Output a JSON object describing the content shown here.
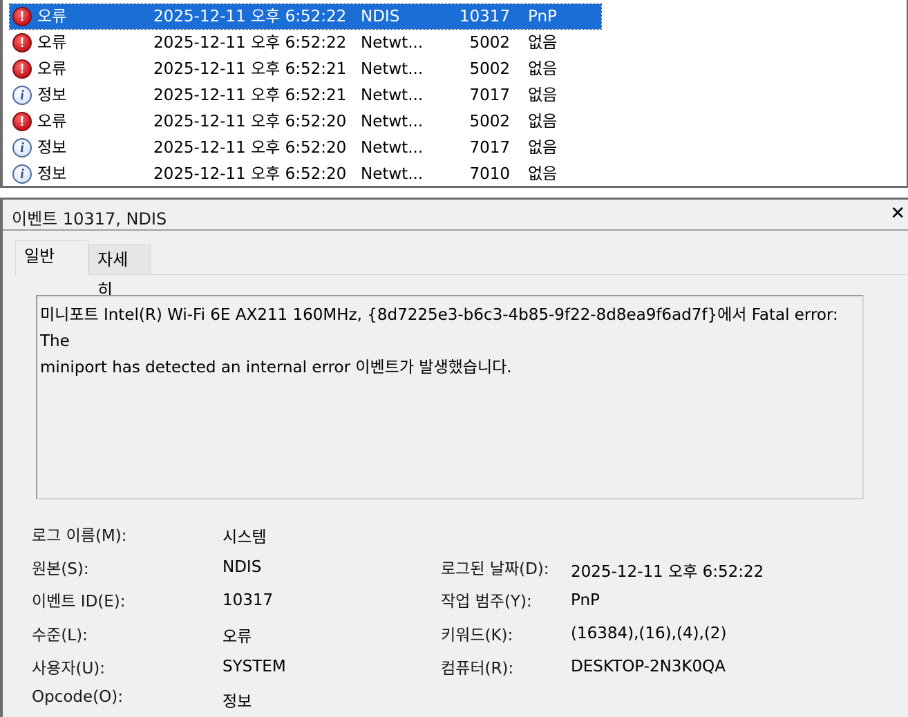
{
  "event_list": {
    "rows": [
      {
        "level": "오류",
        "icon": "error-icon",
        "date": "2025-12-11 오후 6:52:22",
        "source": "NDIS",
        "event_id": "10317",
        "category": "PnP",
        "selected": true
      },
      {
        "level": "오류",
        "icon": "error-icon",
        "date": "2025-12-11 오후 6:52:22",
        "source": "Netwt...",
        "event_id": "5002",
        "category": "없음"
      },
      {
        "level": "오류",
        "icon": "error-icon",
        "date": "2025-12-11 오후 6:52:21",
        "source": "Netwt...",
        "event_id": "5002",
        "category": "없음"
      },
      {
        "level": "정보",
        "icon": "info-icon",
        "date": "2025-12-11 오후 6:52:21",
        "source": "Netwt...",
        "event_id": "7017",
        "category": "없음"
      },
      {
        "level": "오류",
        "icon": "error-icon",
        "date": "2025-12-11 오후 6:52:20",
        "source": "Netwt...",
        "event_id": "5002",
        "category": "없음"
      },
      {
        "level": "정보",
        "icon": "info-icon",
        "date": "2025-12-11 오후 6:52:20",
        "source": "Netwt...",
        "event_id": "7017",
        "category": "없음"
      },
      {
        "level": "정보",
        "icon": "info-icon",
        "date": "2025-12-11 오후 6:52:20",
        "source": "Netwt...",
        "event_id": "7010",
        "category": "없음"
      }
    ]
  },
  "detail": {
    "title": "이벤트 10317, NDIS",
    "close_symbol": "✕",
    "tabs": [
      {
        "label": "일반",
        "active": true
      },
      {
        "label": "자세히",
        "active": false
      }
    ],
    "description_line1": "미니포트 Intel(R) Wi-Fi 6E AX211 160MHz, {8d7225e3-b6c3-4b85-9f22-8d8ea9f6ad7f}에서 Fatal error: The",
    "description_line2": "miniport has detected an internal error 이벤트가 발생했습니다.",
    "fields": {
      "log_name_label": "로그 이름(M):",
      "log_name_value": "시스템",
      "source_label": "원본(S):",
      "source_value": "NDIS",
      "logged_label": "로그된 날짜(D):",
      "logged_value": "2025-12-11 오후 6:52:22",
      "event_id_label": "이벤트 ID(E):",
      "event_id_value": "10317",
      "task_label": "작업 범주(Y):",
      "task_value": "PnP",
      "level_label": "수준(L):",
      "level_value": "오류",
      "keywords_label": "키워드(K):",
      "keywords_value": "(16384),(16),(4),(2)",
      "user_label": "사용자(U):",
      "user_value": "SYSTEM",
      "computer_label": "컴퓨터(R):",
      "computer_value": "DESKTOP-2N3K0QA",
      "opcode_label": "Opcode(O):",
      "opcode_value": "정보"
    }
  },
  "colors": {
    "selection": "#1a6ed6",
    "pane_bg": "#f0f0f0"
  }
}
